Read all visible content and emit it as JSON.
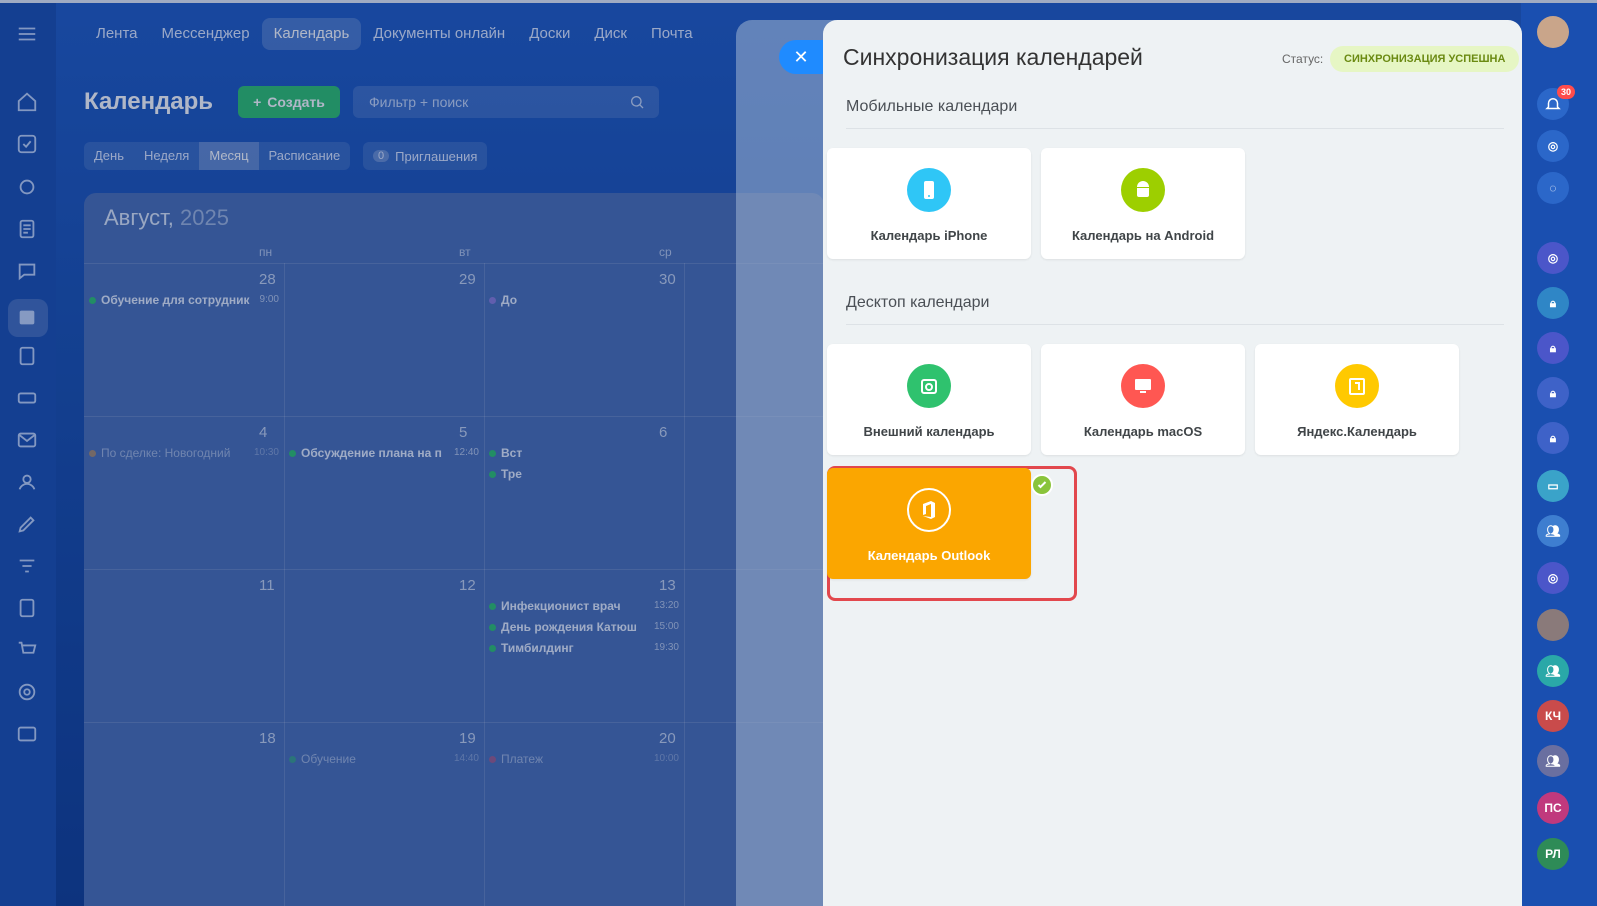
{
  "topnav": {
    "items": [
      "Лента",
      "Мессенджер",
      "Календарь",
      "Документы онлайн",
      "Доски",
      "Диск",
      "Почта"
    ],
    "active_index": 2
  },
  "calendar_page": {
    "title": "Календарь",
    "create_label": "Создать",
    "search_placeholder": "Фильтр + поиск",
    "view_tabs": [
      "День",
      "Неделя",
      "Месяц",
      "Расписание"
    ],
    "active_view": "Месяц",
    "invites_count": "0",
    "invites_label": "Приглашения",
    "month": "Август,",
    "year": "2025",
    "weekdays": [
      "пн",
      "вт",
      "ср"
    ],
    "rows": [
      {
        "days": [
          "28",
          "29",
          "30"
        ],
        "events": [
          {
            "col": 0,
            "text": "Обучение для сотрудник",
            "time": "9:00",
            "color": "#2fc26e"
          },
          {
            "col": 2,
            "text": "До",
            "time": "",
            "color": "#8b7ddb"
          }
        ]
      },
      {
        "days": [
          "4",
          "5",
          "6"
        ],
        "events": [
          {
            "col": 0,
            "text": "По сделке: Новогодний",
            "time": "10:30",
            "color": "#f0a23b",
            "dim": true
          },
          {
            "col": 1,
            "text": "Обсуждение плана на п",
            "time": "12:40",
            "color": "#2fc26e"
          },
          {
            "col": 2,
            "text": "Вст",
            "time": "",
            "color": "#2fc26e"
          },
          {
            "col": 2,
            "text": "Тре",
            "time": "",
            "color": "#2fc26e",
            "line": 1
          }
        ]
      },
      {
        "days": [
          "11",
          "12",
          "13"
        ],
        "events": [
          {
            "col": 2,
            "text": "Инфекционист врач",
            "time": "13:20",
            "color": "#2fc26e"
          },
          {
            "col": 2,
            "text": "День рождения Катюш",
            "time": "15:00",
            "color": "#2fc26e",
            "line": 1
          },
          {
            "col": 2,
            "text": "Тимбилдинг",
            "time": "19:30",
            "color": "#2fc26e",
            "line": 2
          }
        ]
      },
      {
        "days": [
          "18",
          "19",
          "20"
        ],
        "events": [
          {
            "col": 1,
            "text": "Обучение",
            "time": "14:40",
            "color": "#2fc26e",
            "dim": true
          },
          {
            "col": 2,
            "text": "Платеж",
            "time": "10:00",
            "color": "#e04f6f",
            "dim": true
          }
        ]
      }
    ]
  },
  "sync_panel": {
    "title": "Синхронизация календарей",
    "status_label": "Статус:",
    "status_value": "СИНХРОНИЗАЦИЯ УСПЕШНА",
    "mobile_section": "Мобильные календари",
    "desktop_section": "Десктоп календари",
    "cards": [
      {
        "label": "Календарь iPhone",
        "icon": "apple-phone-icon",
        "color": "#2fc6f6"
      },
      {
        "label": "Календарь на Android",
        "icon": "android-icon",
        "color": "#9dcf00"
      },
      {
        "label": "Внешний календарь",
        "icon": "sync-calendar-icon",
        "color": "#2fc26e"
      },
      {
        "label": "Календарь macOS",
        "icon": "mac-icon",
        "color": "#ff5752"
      },
      {
        "label": "Яндекс.Календарь",
        "icon": "yandex-calendar-icon",
        "color": "#ffc900"
      },
      {
        "label": "Календарь Outlook",
        "icon": "office-icon",
        "color": "#fba600",
        "selected": true
      }
    ]
  },
  "right_rail": {
    "notification_count": "30",
    "avatars": [
      "КЧ",
      "ПС",
      "РЛ"
    ]
  }
}
